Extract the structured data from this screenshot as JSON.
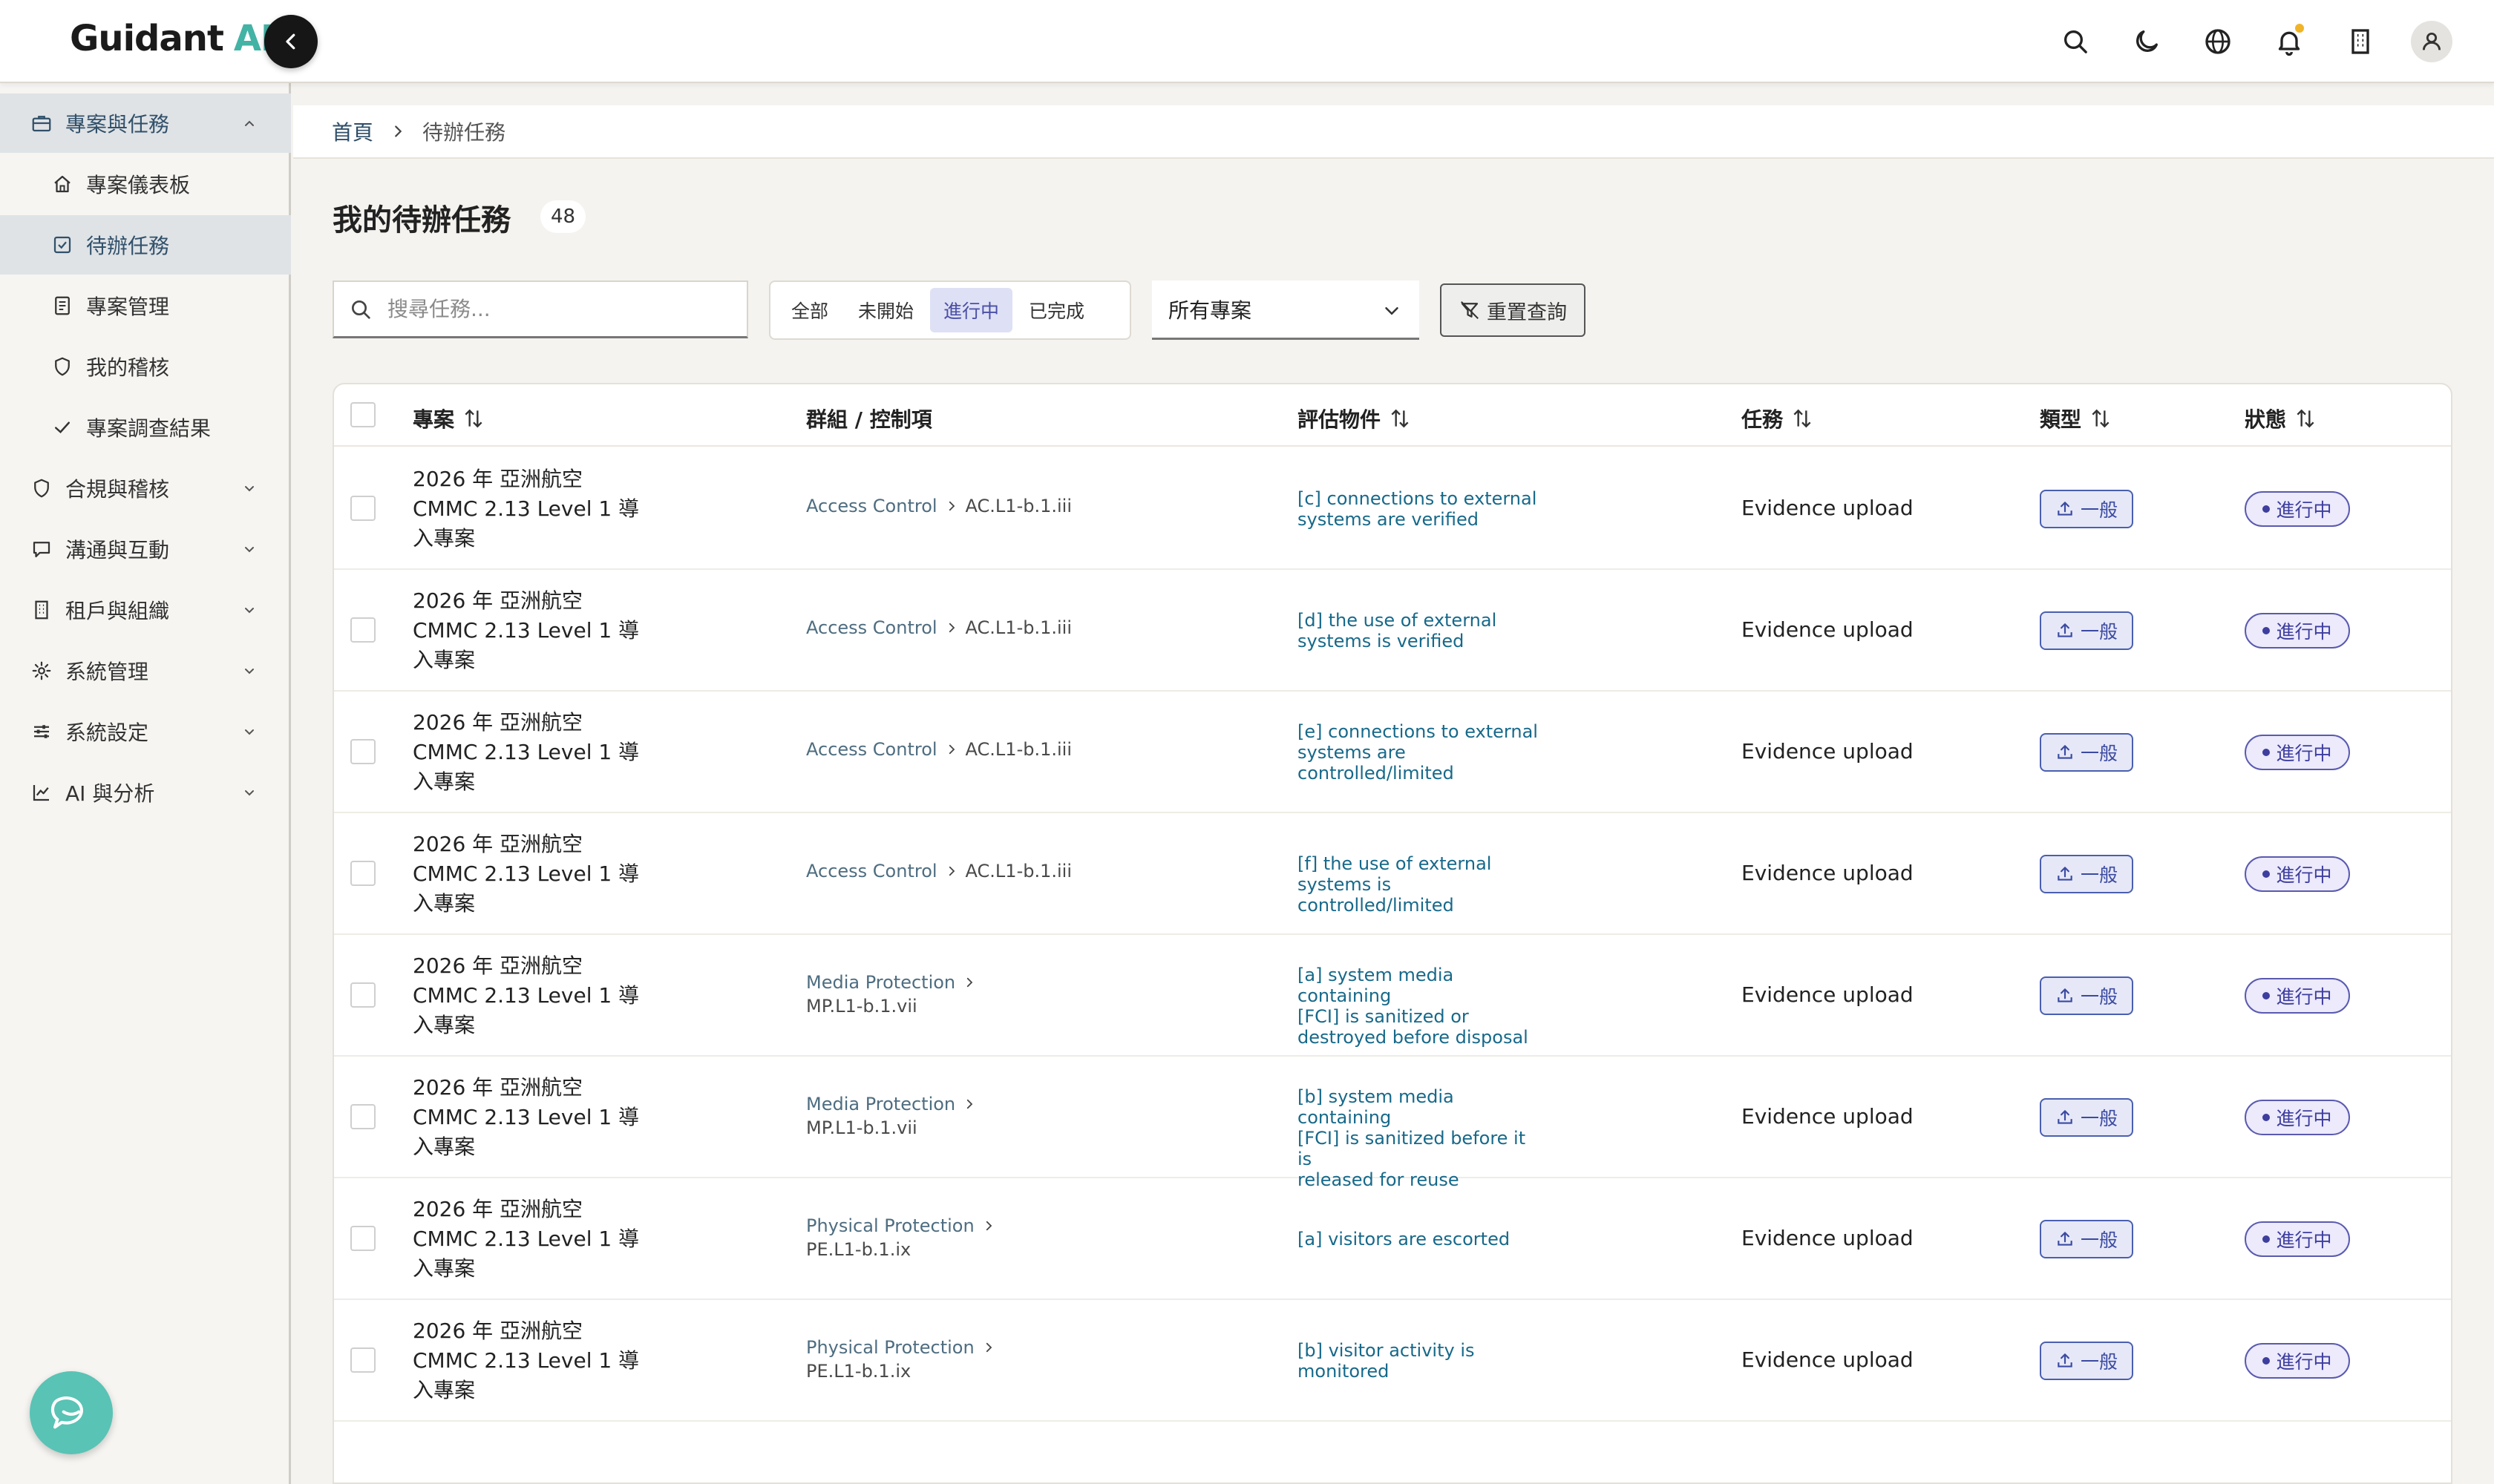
{
  "app": {
    "logo_main": "Guidant",
    "logo_ai": "AI"
  },
  "sidebar": {
    "items": [
      {
        "label": "專案與任務",
        "icon": "briefcase-icon"
      },
      {
        "label": "專案儀表板",
        "icon": "home-icon"
      },
      {
        "label": "待辦任務",
        "icon": "checkbox-icon"
      },
      {
        "label": "專案管理",
        "icon": "document-icon"
      },
      {
        "label": "我的稽核",
        "icon": "shield-icon"
      },
      {
        "label": "專案調查結果",
        "icon": "check-icon"
      },
      {
        "label": "合規與稽核",
        "icon": "shield-icon"
      },
      {
        "label": "溝通與互動",
        "icon": "chat-icon"
      },
      {
        "label": "租戶與組織",
        "icon": "building-icon"
      },
      {
        "label": "系統管理",
        "icon": "gear-icon"
      },
      {
        "label": "系統設定",
        "icon": "sliders-icon"
      },
      {
        "label": "AI 與分析",
        "icon": "chart-icon"
      }
    ]
  },
  "breadcrumb": {
    "home": "首頁",
    "current": "待辦任務"
  },
  "page": {
    "title": "我的待辦任務",
    "count": "48"
  },
  "search": {
    "placeholder": "搜尋任務..."
  },
  "filters": {
    "options": [
      "全部",
      "未開始",
      "進行中",
      "已完成"
    ],
    "active": "進行中"
  },
  "project_select": {
    "value": "所有專案"
  },
  "reset_label": "重置查詢",
  "table": {
    "headers": {
      "project": "專案",
      "group": "群組 / 控制項",
      "object": "評估物件",
      "task": "任務",
      "type": "類型",
      "status": "狀態"
    },
    "rows": [
      {
        "project": [
          "2026 年 亞洲航空",
          "CMMC 2.13 Level 1 導",
          "入專案"
        ],
        "group": "Access Control",
        "control": "AC.L1-b.1.iii",
        "object": [
          "[c] connections to external",
          "systems are verified"
        ],
        "task": "Evidence upload",
        "type": "一般",
        "status": "進行中"
      },
      {
        "project": [
          "2026 年 亞洲航空",
          "CMMC 2.13 Level 1 導",
          "入專案"
        ],
        "group": "Access Control",
        "control": "AC.L1-b.1.iii",
        "object": [
          "[d] the use of external",
          "systems is verified"
        ],
        "task": "Evidence upload",
        "type": "一般",
        "status": "進行中"
      },
      {
        "project": [
          "2026 年 亞洲航空",
          "CMMC 2.13 Level 1 導",
          "入專案"
        ],
        "group": "Access Control",
        "control": "AC.L1-b.1.iii",
        "object": [
          "[e] connections to external",
          "systems are",
          "controlled/limited"
        ],
        "task": "Evidence upload",
        "type": "一般",
        "status": "進行中"
      },
      {
        "project": [
          "2026 年 亞洲航空",
          "CMMC 2.13 Level 1 導",
          "入專案"
        ],
        "group": "Access Control",
        "control": "AC.L1-b.1.iii",
        "object": [
          "[f] the use of external",
          "systems is controlled/limited"
        ],
        "task": "Evidence upload",
        "type": "一般",
        "status": "進行中"
      },
      {
        "project": [
          "2026 年 亞洲航空",
          "CMMC 2.13 Level 1 導",
          "入專案"
        ],
        "group": "Media Protection",
        "control": "MP.L1-b.1.vii",
        "object": [
          "[a] system media containing",
          "[FCI] is sanitized or",
          "destroyed before disposal"
        ],
        "task": "Evidence upload",
        "type": "一般",
        "status": "進行中"
      },
      {
        "project": [
          "2026 年 亞洲航空",
          "CMMC 2.13 Level 1 導",
          "入專案"
        ],
        "group": "Media Protection",
        "control": "MP.L1-b.1.vii",
        "object": [
          "[b] system media containing",
          "[FCI] is sanitized before it is",
          "released for reuse"
        ],
        "task": "Evidence upload",
        "type": "一般",
        "status": "進行中"
      },
      {
        "project": [
          "2026 年 亞洲航空",
          "CMMC 2.13 Level 1 導",
          "入專案"
        ],
        "group": "Physical Protection",
        "control": "PE.L1-b.1.ix",
        "object": [
          "[a] visitors are escorted"
        ],
        "task": "Evidence upload",
        "type": "一般",
        "status": "進行中"
      },
      {
        "project": [
          "2026 年 亞洲航空",
          "CMMC 2.13 Level 1 導",
          "入專案"
        ],
        "group": "Physical Protection",
        "control": "PE.L1-b.1.ix",
        "object": [
          "[b] visitor activity is",
          "monitored"
        ],
        "task": "Evidence upload",
        "type": "一般",
        "status": "進行中"
      }
    ]
  },
  "colors": {
    "accent_teal": "#43b3a5",
    "link_blue": "#17698a",
    "status_purple": "#3e3e9e",
    "notification_dot": "#f0b429"
  }
}
